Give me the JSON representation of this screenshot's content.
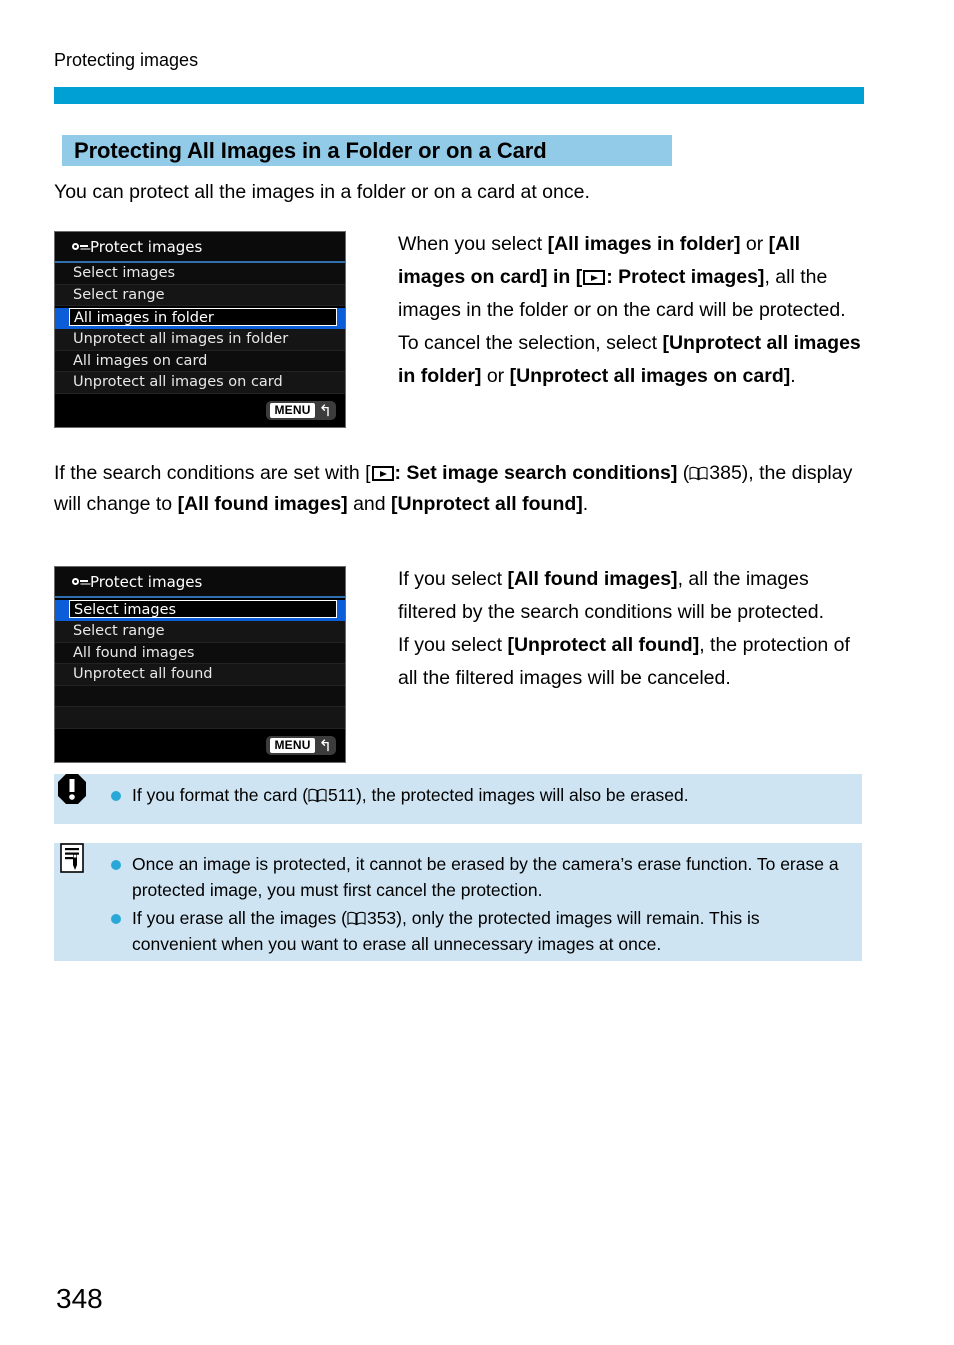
{
  "page": {
    "running_head": "Protecting images",
    "folio": "348",
    "accent_bar_color": "#009FD4",
    "heading_highlight_color": "#92CBE8",
    "note_box_color": "#CFE4F2",
    "bullet_color": "#29A8D8",
    "menu_highlight_color": "#0b5ed7"
  },
  "section": {
    "heading": "Protecting All Images in a Folder or on a Card",
    "intro": "You can protect all the images in a folder or on a card at once."
  },
  "lcd_first": {
    "title": "Protect images",
    "title_icon": "key-icon",
    "rows": [
      {
        "label": "Select images",
        "selected": false
      },
      {
        "label": "Select range",
        "selected": false
      },
      {
        "label": "All images in folder",
        "selected": true
      },
      {
        "label": "Unprotect all images in folder",
        "selected": false
      },
      {
        "label": "All images on card",
        "selected": false
      },
      {
        "label": "Unprotect all images on card",
        "selected": false
      }
    ],
    "menu_button": "MENU",
    "return_arrow": "↰"
  },
  "lcd_second": {
    "title": "Protect images",
    "title_icon": "key-icon",
    "rows": [
      {
        "label": "Select images",
        "selected": true
      },
      {
        "label": "Select range",
        "selected": false
      },
      {
        "label": "All found images",
        "selected": false
      },
      {
        "label": "Unprotect all found",
        "selected": false
      },
      {
        "label": "",
        "selected": false
      },
      {
        "label": "",
        "selected": false
      }
    ],
    "menu_button": "MENU",
    "return_arrow": "↰"
  },
  "copy": {
    "first_block": {
      "p1_a": "When you select ",
      "p1_b": "[All images in folder]",
      "p1_c": " or ",
      "p1_d": "[All images on card]",
      "p1_e": " in [",
      "p1_icon": "playback-icon",
      "p1_f": ": Protect images]",
      "p1_g": ", all the images in the folder or on the card will be protected.",
      "p2_a": "To cancel the selection, select ",
      "p2_b": "[Unprotect all images in folder]",
      "p2_c": " or ",
      "p2_d": "[Unprotect all images on card]",
      "p2_e": "."
    },
    "middle_block": {
      "a": "If the search conditions are set with [",
      "icon": "playback-icon",
      "b": ": Set image search conditions]",
      "c": " (",
      "book_icon": "book-icon",
      "page_ref": "385",
      "d": "), the display will change to ",
      "e": "[All found images]",
      "f": " and ",
      "g": "[Unprotect all found]",
      "h": "."
    },
    "second_block": {
      "p1_a": "If you select ",
      "p1_b": "[All found images]",
      "p1_c": ", all the images filtered by the search conditions will be protected.",
      "p2_a": "If you select ",
      "p2_b": "[Unprotect all found]",
      "p2_c": ", the protection of all the filtered images will be canceled."
    }
  },
  "caution_box": {
    "icon": "caution-octagon-icon",
    "items": [
      {
        "a": "If you format the card (",
        "book_icon": "book-icon",
        "page_ref": "511",
        "b": "), the protected images will also be erased."
      }
    ]
  },
  "note_box": {
    "icon": "memo-note-icon",
    "items": [
      {
        "text": "Once an image is protected, it cannot be erased by the camera’s erase function. To erase a protected image, you must first cancel the protection."
      },
      {
        "a": "If you erase all the images (",
        "book_icon": "book-icon",
        "page_ref": "353",
        "b": "), only the protected images will remain. This is convenient when you want to erase all unnecessary images at once."
      }
    ]
  }
}
